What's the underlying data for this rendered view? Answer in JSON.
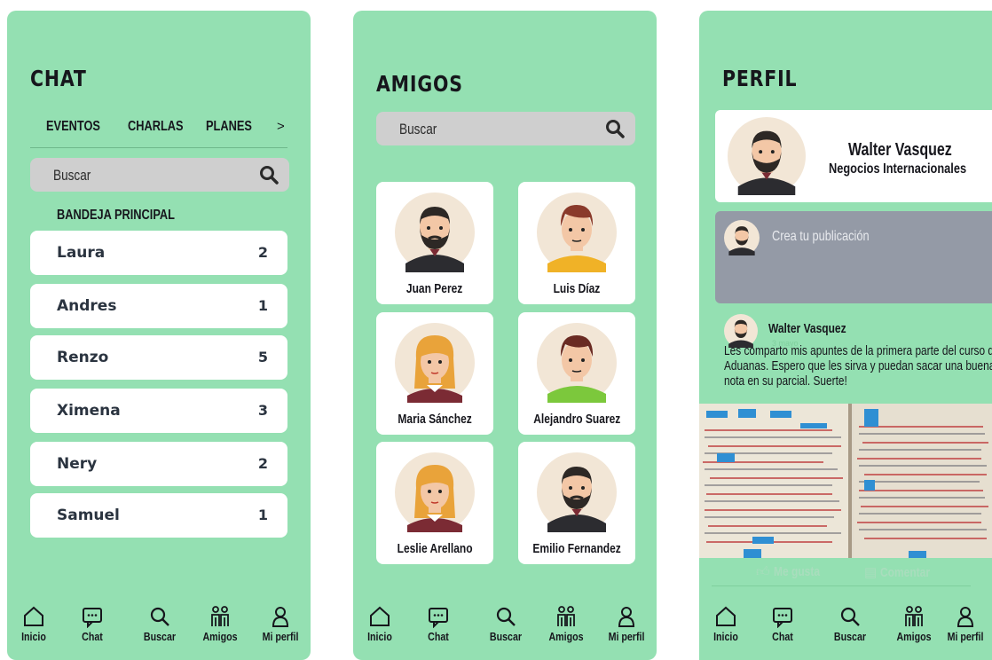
{
  "chat": {
    "title": "CHAT",
    "tabs": [
      "EVENTOS",
      "CHARLAS",
      "PLANES",
      ">"
    ],
    "search_placeholder": "Buscar",
    "section": "BANDEJA PRINCIPAL",
    "conversations": [
      {
        "name": "Laura",
        "count": "2"
      },
      {
        "name": "Andres",
        "count": "1"
      },
      {
        "name": "Renzo",
        "count": "5"
      },
      {
        "name": "Ximena",
        "count": "3"
      },
      {
        "name": "Nery",
        "count": "2"
      },
      {
        "name": "Samuel",
        "count": "1"
      }
    ]
  },
  "amigos": {
    "title": "AMIGOS",
    "search_placeholder": "Buscar",
    "friends": [
      {
        "name": "Juan Perez",
        "avatar": "bearded-man"
      },
      {
        "name": "Luis Díaz",
        "avatar": "young-man-yellow"
      },
      {
        "name": "Maria Sánchez",
        "avatar": "woman-blonde"
      },
      {
        "name": "Alejandro Suarez",
        "avatar": "young-man-green"
      },
      {
        "name": "Leslie Arellano",
        "avatar": "woman-blonde"
      },
      {
        "name": "Emilio Fernandez",
        "avatar": "bearded-man"
      }
    ]
  },
  "perfil": {
    "title": "PERFIL",
    "user_name": "Walter Vasquez",
    "career": "Negocios Internacionales",
    "create_post": "Crea tu publicación",
    "post": {
      "author": "Walter Vasquez",
      "time": "3 mayo",
      "text": "Les comparto mis apuntes de la primera parte del curso de Aduanas. Espero que les sirva y puedan sacar una buena nota en su parcial. Suerte!",
      "like": "Me gusta",
      "comment": "Comentar"
    }
  },
  "nav": [
    "Inicio",
    "Chat",
    "Buscar",
    "Amigos",
    "Mi perfil"
  ],
  "colors": {
    "background": "#94e0b2",
    "card": "#ffffff",
    "search": "#cfcfcf",
    "create_post": "#949aa6"
  }
}
